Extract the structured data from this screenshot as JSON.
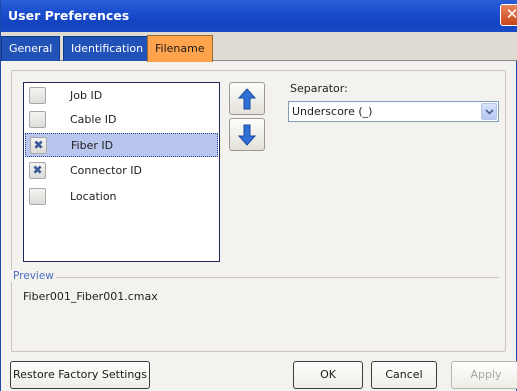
{
  "window": {
    "title": "User Preferences",
    "close_glyph": "✕"
  },
  "tabs": [
    {
      "label": "General",
      "active": false
    },
    {
      "label": "Identification",
      "active": false
    },
    {
      "label": "Filename",
      "active": true
    }
  ],
  "filename_items": [
    {
      "label": "Job ID",
      "checked": false,
      "selected": false,
      "mark": ""
    },
    {
      "label": "Cable ID",
      "checked": false,
      "selected": false,
      "mark": ""
    },
    {
      "label": "Fiber ID",
      "checked": true,
      "selected": true,
      "mark": "✖"
    },
    {
      "label": "Connector ID",
      "checked": true,
      "selected": false,
      "mark": "✖"
    },
    {
      "label": "Location",
      "checked": false,
      "selected": false,
      "mark": ""
    }
  ],
  "move_buttons": {
    "up_icon": "arrow-up-icon",
    "down_icon": "arrow-down-icon"
  },
  "separator": {
    "label": "Separator:",
    "value": "Underscore (_)"
  },
  "preview": {
    "legend": "Preview",
    "value": "Fiber001_Fiber001.cmax"
  },
  "buttons": {
    "restore": "Restore Factory Settings",
    "ok": "OK",
    "cancel": "Cancel",
    "apply": "Apply"
  },
  "colors": {
    "titlebar": "#1b4fd1",
    "tab_active": "#ffa34d",
    "tab_inactive": "#2152b8",
    "arrow_blue": "#2f6fd8"
  }
}
